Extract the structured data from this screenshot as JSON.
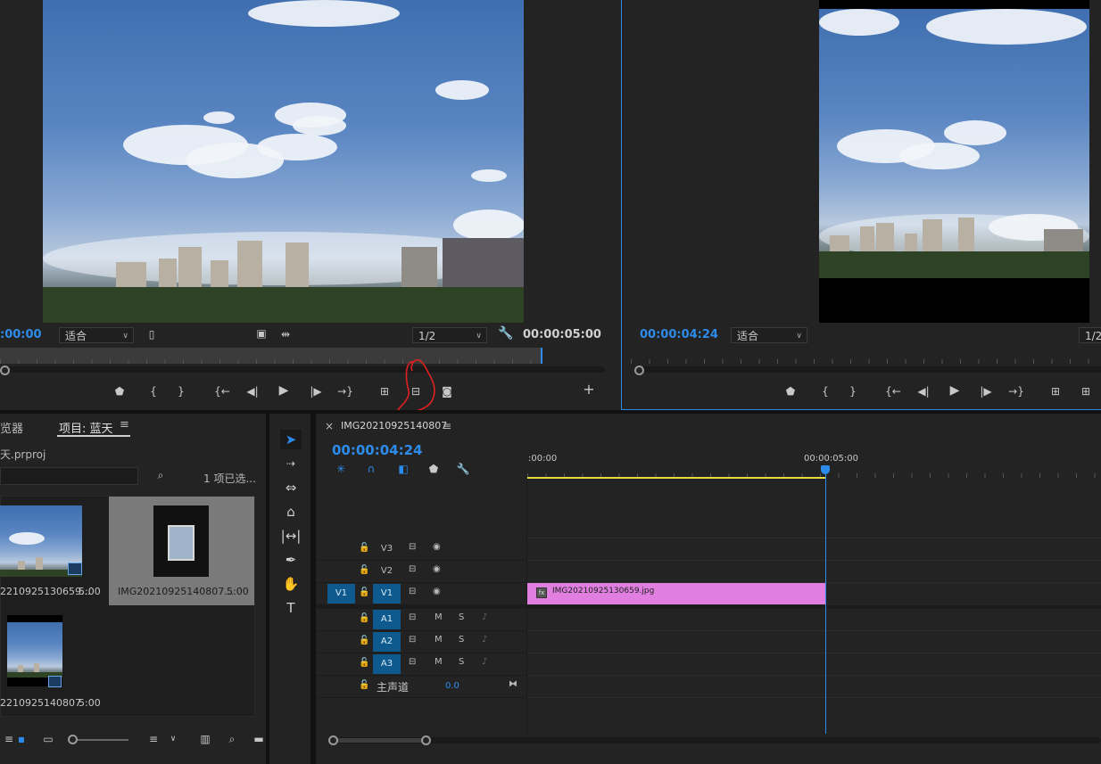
{
  "source_monitor": {
    "timecode_left": ":00:00",
    "fit": "适合",
    "resolution": "1/2",
    "duration": "00:00:05:00"
  },
  "program_monitor": {
    "timecode": "00:00:04:24",
    "fit": "适合",
    "resolution": "1/2"
  },
  "project_panel": {
    "tab_browser": "览器",
    "tab_project": "项目: 蓝天",
    "menu": "≡",
    "file": "天.prproj",
    "selected": "1 项已选...",
    "items": [
      {
        "name": "2210925130659...",
        "duration": "5:00"
      },
      {
        "name": "IMG20210925140807...",
        "duration": "5:00"
      },
      {
        "name": "2210925140807",
        "duration": "5:00"
      }
    ]
  },
  "timeline": {
    "close": "×",
    "sequence": "IMG20210925140807",
    "menu": "≡",
    "timecode": "00:00:04:24",
    "ruler_start": ":00:00",
    "ruler_mark": "00:00:05:00",
    "playhead_fraction": 1.0,
    "clip_label": "IMG20210925130659.jpg",
    "clip_color": "#e07fe0",
    "tracks": {
      "v3": "V3",
      "v2": "V2",
      "v1": "V1",
      "v1_src": "V1",
      "a1": "A1",
      "a2": "A2",
      "a3": "A3",
      "m": "M",
      "s": "S",
      "master": "主声道",
      "master_value": "0.0"
    }
  },
  "icons": {
    "marker": "marker-icon",
    "in": "mark-in-icon",
    "out": "mark-out-icon",
    "play": "play-icon",
    "camera": "camera-icon",
    "wrench": "wrench-icon",
    "plus": "plus-icon"
  },
  "colors": {
    "accent": "#2d8ceb",
    "track_on": "#0e5a8e",
    "work_area": "#e6dc3c",
    "annotation": "#e02020"
  }
}
